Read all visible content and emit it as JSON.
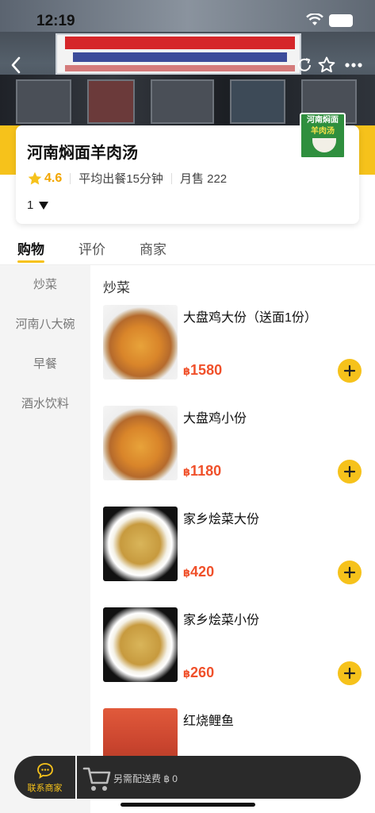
{
  "status": {
    "time": "12:19"
  },
  "shop": {
    "name": "河南焖面羊肉汤",
    "rating": "4.6",
    "avg_time": "平均出餐15分钟",
    "monthly_sales": "月售 222",
    "quantity": "1"
  },
  "logo": {
    "line1": "河南焖面",
    "line2": "羊肉汤"
  },
  "tabs": [
    {
      "label": "购物"
    },
    {
      "label": "评价"
    },
    {
      "label": "商家"
    }
  ],
  "sidebar": {
    "items": [
      {
        "label": "炒菜"
      },
      {
        "label": "河南八大碗"
      },
      {
        "label": "早餐"
      },
      {
        "label": "酒水饮料"
      }
    ]
  },
  "menu": {
    "section_title": "炒菜",
    "currency": "฿",
    "dishes": [
      {
        "name": "大盘鸡大份（送面1份）",
        "price": "1580"
      },
      {
        "name": "大盘鸡小份",
        "price": "1180"
      },
      {
        "name": "家乡烩菜大份",
        "price": "420"
      },
      {
        "name": "家乡烩菜小份",
        "price": "260"
      },
      {
        "name": "红烧鲤鱼",
        "price": ""
      }
    ]
  },
  "bottom": {
    "contact_label": "联系商家",
    "delivery_fee": "另需配送费 ฿ 0"
  },
  "colors": {
    "accent": "#f6c21b",
    "price": "#f0502a",
    "bar": "#2a2a2a"
  }
}
